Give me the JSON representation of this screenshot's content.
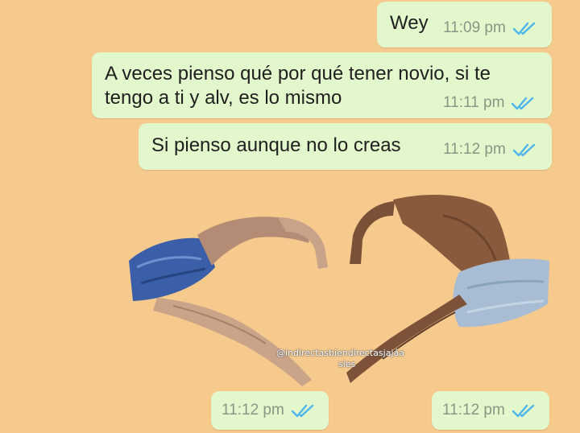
{
  "messages": [
    {
      "text": "Wey",
      "time": "11:09 pm",
      "status": "read"
    },
    {
      "text": "A veces pienso qué por qué tener novio, si te tengo a ti y alv, es lo mismo",
      "time": "11:11 pm",
      "status": "read"
    },
    {
      "text": "Si pienso aunque no lo creas",
      "time": "11:12 pm",
      "status": "read"
    }
  ],
  "stickers": [
    {
      "time": "11:12 pm",
      "status": "read"
    },
    {
      "time": "11:12 pm",
      "status": "read"
    }
  ],
  "watermark": {
    "line1": "@indirectasbiendirectasjajáa",
    "line2": "sies"
  },
  "colors": {
    "wallpaper": "#f6c98d",
    "outgoing_bubble": "#e2f7cb",
    "read_ticks": "#4fb6ec",
    "timestamp": "#8a9585"
  }
}
